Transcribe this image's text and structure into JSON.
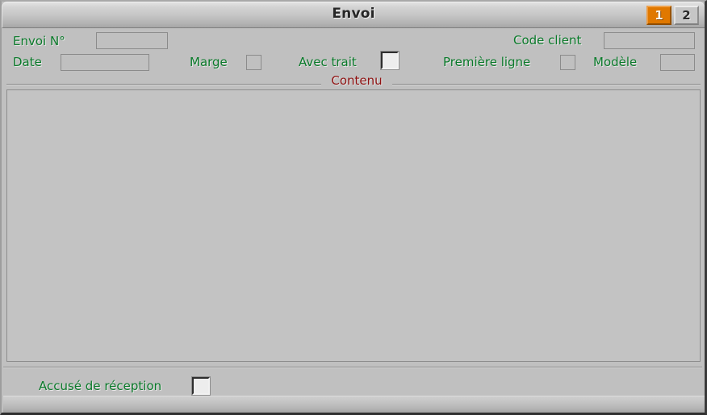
{
  "window": {
    "title": "Envoi"
  },
  "tabs": [
    {
      "label": "1",
      "state": "active"
    },
    {
      "label": "2",
      "state": "inactive"
    }
  ],
  "form": {
    "envoi_numero": {
      "label": "Envoi N°",
      "value": ""
    },
    "date": {
      "label": "Date",
      "value": ""
    },
    "marge": {
      "label": "Marge",
      "checked": false
    },
    "avec_trait": {
      "label": "Avec trait",
      "checked": false
    },
    "code_client": {
      "label": "Code client",
      "value": ""
    },
    "premiere_ligne": {
      "label": "Première ligne",
      "checked": false
    },
    "modele": {
      "label": "Modèle",
      "value": ""
    }
  },
  "content_group": {
    "title": "Contenu",
    "text": ""
  },
  "footer": {
    "accuse_reception": {
      "label": "Accusé de réception",
      "checked": false
    }
  },
  "colors": {
    "label_green": "#0a7a2a",
    "group_title_red": "#8f1212",
    "tab_active_orange": "#e07800",
    "panel_gray": "#c0c0c0"
  }
}
